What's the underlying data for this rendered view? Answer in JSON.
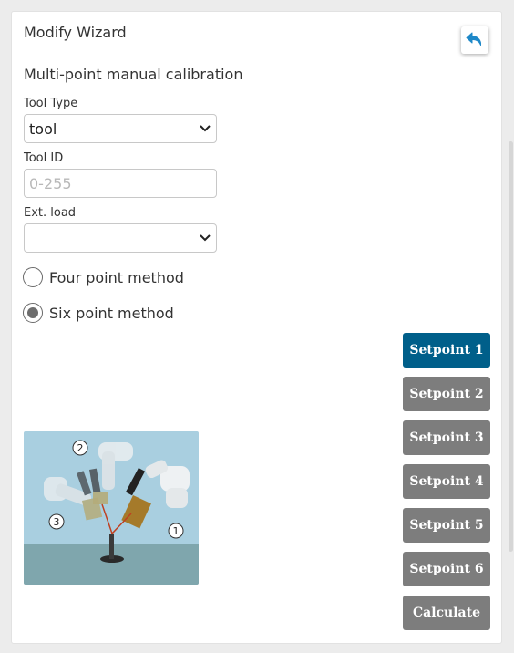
{
  "wizard": {
    "title": "Modify Wizard",
    "subtitle": "Multi-point manual calibration"
  },
  "form": {
    "tool_type": {
      "label": "Tool Type",
      "value": "tool"
    },
    "tool_id": {
      "label": "Tool ID",
      "value": "",
      "placeholder": "0-255"
    },
    "ext_load": {
      "label": "Ext. load",
      "value": ""
    }
  },
  "methods": [
    {
      "label": "Four point method",
      "selected": false
    },
    {
      "label": "Six point method",
      "selected": true
    }
  ],
  "setpoints": [
    {
      "label": "Setpoint 1",
      "active": true
    },
    {
      "label": "Setpoint 2",
      "active": false
    },
    {
      "label": "Setpoint 3",
      "active": false
    },
    {
      "label": "Setpoint 4",
      "active": false
    },
    {
      "label": "Setpoint 5",
      "active": false
    },
    {
      "label": "Setpoint 6",
      "active": false
    }
  ],
  "calculate_label": "Calculate",
  "illustration": {
    "markers": [
      "1",
      "2",
      "3"
    ]
  },
  "colors": {
    "accent": "#005f8a",
    "button_gray": "#7d7d7d",
    "back_icon": "#1e88c8"
  },
  "icons": {
    "back": "undo-arrow-icon",
    "dropdown": "chevron-down-icon"
  }
}
